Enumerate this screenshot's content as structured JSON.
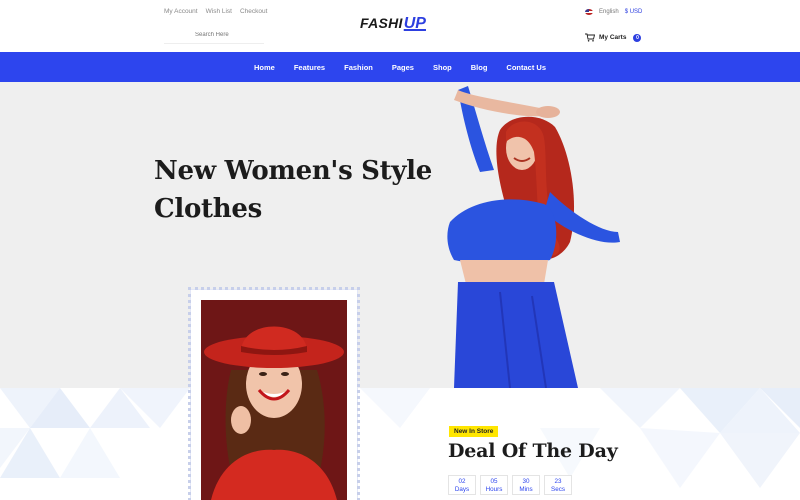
{
  "header": {
    "links": [
      "My Account",
      "Wish List",
      "Checkout"
    ],
    "search_placeholder": "Search Here",
    "logo_part1": "FASHI",
    "logo_part2": "UP",
    "language": "English",
    "currency": "$ USD",
    "cart_label": "My Carts",
    "cart_count": "0"
  },
  "nav": {
    "items": [
      "Home",
      "Features",
      "Fashion",
      "Pages",
      "Shop",
      "Blog",
      "Contact Us"
    ]
  },
  "hero": {
    "title_line1": "New Women's Style",
    "title_line2": "Clothes"
  },
  "deal": {
    "badge": "New In Store",
    "title": "Deal Of The Day",
    "countdown": [
      {
        "value": "02",
        "unit": "Days"
      },
      {
        "value": "05",
        "unit": "Hours"
      },
      {
        "value": "30",
        "unit": "Mins"
      },
      {
        "value": "23",
        "unit": "Secs"
      }
    ]
  },
  "colors": {
    "brand_blue": "#2d45ee",
    "hero_bg": "#efefef",
    "badge_yellow": "#ffe600"
  }
}
